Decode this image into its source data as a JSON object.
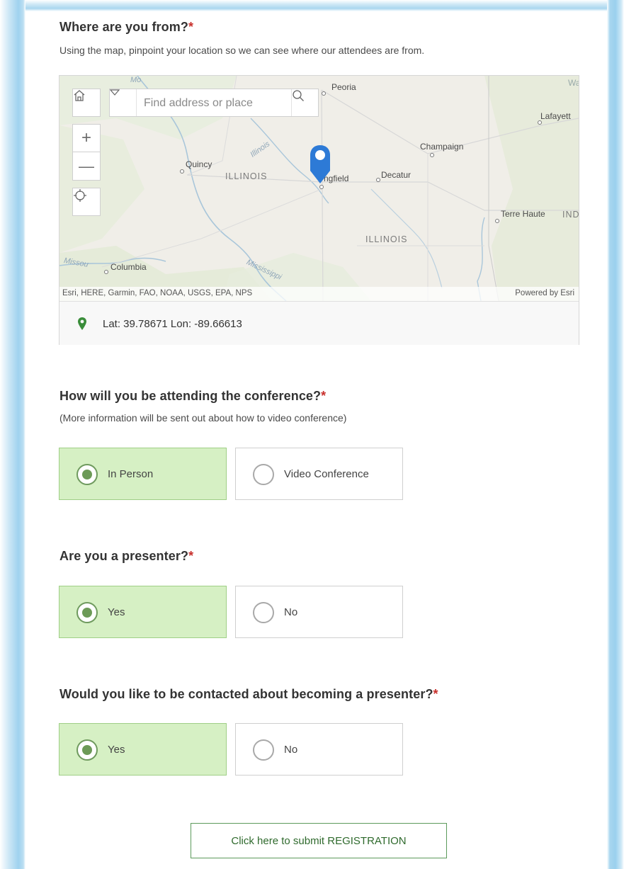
{
  "q1": {
    "title": "Where are you from?",
    "required_mark": "*",
    "subtitle": "Using the map, pinpoint your location so we can see where our attendees are from."
  },
  "map": {
    "search_placeholder": "Find address or place",
    "controls": [
      "home-icon",
      "zoom-in-icon",
      "zoom-out-icon",
      "locate-icon",
      "search-icon",
      "dropdown-icon"
    ],
    "labels": {
      "peoria": "Peoria",
      "lafayette": "Lafayett",
      "champaign": "Champaign",
      "quincy": "Quincy",
      "illinois_west": "ILLINOIS",
      "springfield": "ngfield",
      "decatur": "Decatur",
      "terre_haute": "Terre Haute",
      "ind": "IND",
      "illinois_east": "ILLINOIS",
      "columbia": "Columbia",
      "missouri": "Missou",
      "mississippi": "Mississippi",
      "illinois_river": "Illinois",
      "wa": "Wa",
      "mo": "Mo"
    },
    "attribution_left": "Esri, HERE, Garmin, FAO, NOAA, USGS, EPA, NPS",
    "attribution_right": "Powered by Esri",
    "coords_text": "Lat: 39.78671  Lon: -89.66613"
  },
  "q2": {
    "title": "How will you be attending the conference?",
    "required_mark": "*",
    "subtitle": "(More information will be sent out about how to video conference)",
    "options": [
      {
        "label": "In Person",
        "selected": true
      },
      {
        "label": "Video Conference",
        "selected": false
      }
    ]
  },
  "q3": {
    "title": "Are you a presenter?",
    "required_mark": "*",
    "options": [
      {
        "label": "Yes",
        "selected": true
      },
      {
        "label": "No",
        "selected": false
      }
    ]
  },
  "q4": {
    "title": "Would you like to be contacted about becoming a presenter?",
    "required_mark": "*",
    "options": [
      {
        "label": "Yes",
        "selected": true
      },
      {
        "label": "No",
        "selected": false
      }
    ]
  },
  "submit_label": "Click here to submit REGISTRATION",
  "colors": {
    "selected_bg": "#d6f0c4",
    "accent_green": "#5c9a5b",
    "required_red": "#c8302c",
    "map_pin_blue": "#2d7ad6",
    "coords_pin_green": "#3a8d3a"
  }
}
